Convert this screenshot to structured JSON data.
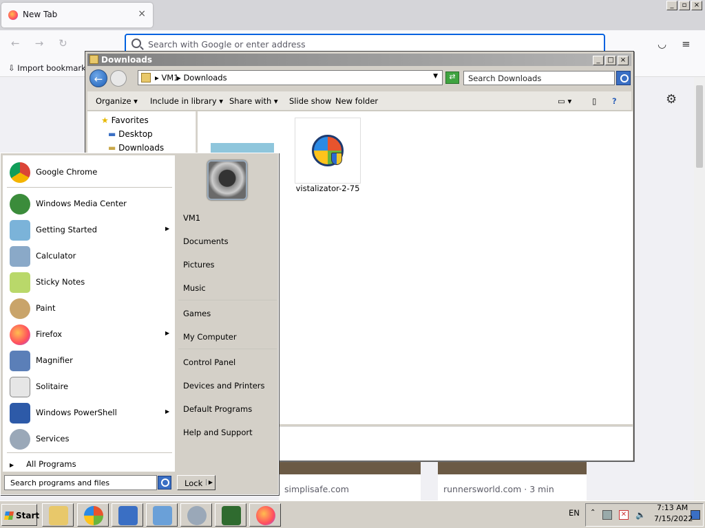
{
  "firefox": {
    "tab_title": "New Tab",
    "tab_close": "×",
    "url_placeholder": "Search with Google or enter address",
    "bookmark_import": "Import bookmarks...",
    "tiles": [
      {
        "label": "simplisafe.com"
      },
      {
        "label": "runnersworld.com · 3 min"
      }
    ],
    "window_buttons": [
      "_",
      "▫",
      "×"
    ]
  },
  "explorer": {
    "title": "Downloads",
    "address": {
      "parts": [
        "VM1",
        "Downloads"
      ],
      "separator": "▸"
    },
    "search_placeholder": "Search Downloads",
    "toolbar": [
      "Organize",
      "Include in library",
      "Share with",
      "Slide show",
      "New folder"
    ],
    "nav": [
      {
        "label": "Favorites",
        "icon": "star-icon"
      },
      {
        "label": "Desktop",
        "icon": "desktop-icon"
      },
      {
        "label": "Downloads",
        "icon": "folder-icon"
      }
    ],
    "file": {
      "name": "vistalizator-2-75",
      "icon": "windows-installer-icon"
    },
    "window_buttons": [
      "_",
      "□",
      "×"
    ]
  },
  "start_menu": {
    "pinned": [
      {
        "label": "Google Chrome",
        "icon": "chrome-icon",
        "color": "#db4437"
      }
    ],
    "programs": [
      {
        "label": "Windows Media Center",
        "icon": "media-center-icon",
        "color": "#3b8c3b",
        "arrow": false
      },
      {
        "label": "Getting Started",
        "icon": "getting-started-icon",
        "color": "#7bb3d9",
        "arrow": true
      },
      {
        "label": "Calculator",
        "icon": "calculator-icon",
        "color": "#8aa9c8",
        "arrow": false
      },
      {
        "label": "Sticky Notes",
        "icon": "sticky-notes-icon",
        "color": "#b9d86a",
        "arrow": false
      },
      {
        "label": "Paint",
        "icon": "paint-icon",
        "color": "#c9a46a",
        "arrow": false
      },
      {
        "label": "Firefox",
        "icon": "firefox-icon",
        "color": "#ff7139",
        "arrow": true
      },
      {
        "label": "Magnifier",
        "icon": "magnifier-icon",
        "color": "#5b7fb8",
        "arrow": false
      },
      {
        "label": "Solitaire",
        "icon": "solitaire-icon",
        "color": "#e6e6e6",
        "arrow": false
      },
      {
        "label": "Windows PowerShell",
        "icon": "powershell-icon",
        "color": "#2d5aa8",
        "arrow": true
      },
      {
        "label": "Services",
        "icon": "services-icon",
        "color": "#9aa8b8",
        "arrow": false
      }
    ],
    "all_programs": "All Programs",
    "search_placeholder": "Search programs and files",
    "lock": "Lock",
    "right_items": [
      {
        "label": "VM1"
      },
      {
        "label": "Documents"
      },
      {
        "label": "Pictures"
      },
      {
        "label": "Music"
      },
      {
        "label": "Games"
      },
      {
        "label": "My Computer"
      },
      {
        "label": "Control Panel"
      },
      {
        "label": "Devices and Printers"
      },
      {
        "label": "Default Programs"
      },
      {
        "label": "Help and Support"
      }
    ]
  },
  "taskbar": {
    "start": "Start",
    "buttons": [
      {
        "name": "explorer",
        "icon": "folder-icon",
        "color": "#e8c86a"
      },
      {
        "name": "chrome",
        "icon": "windows-orb-icon",
        "color": "#2b6ad1"
      },
      {
        "name": "app3",
        "icon": "monitor-icon",
        "color": "#3a6fc4"
      },
      {
        "name": "app4",
        "icon": "network-icon",
        "color": "#6aa0d8"
      },
      {
        "name": "app5",
        "icon": "gear-icon",
        "color": "#9aa8b8"
      },
      {
        "name": "app6",
        "icon": "task-manager-icon",
        "color": "#2f6b2f"
      },
      {
        "name": "firefox",
        "icon": "firefox-icon",
        "color": "#ff7139"
      }
    ],
    "language": "EN",
    "time": "7:13 AM",
    "date": "7/15/2022"
  }
}
